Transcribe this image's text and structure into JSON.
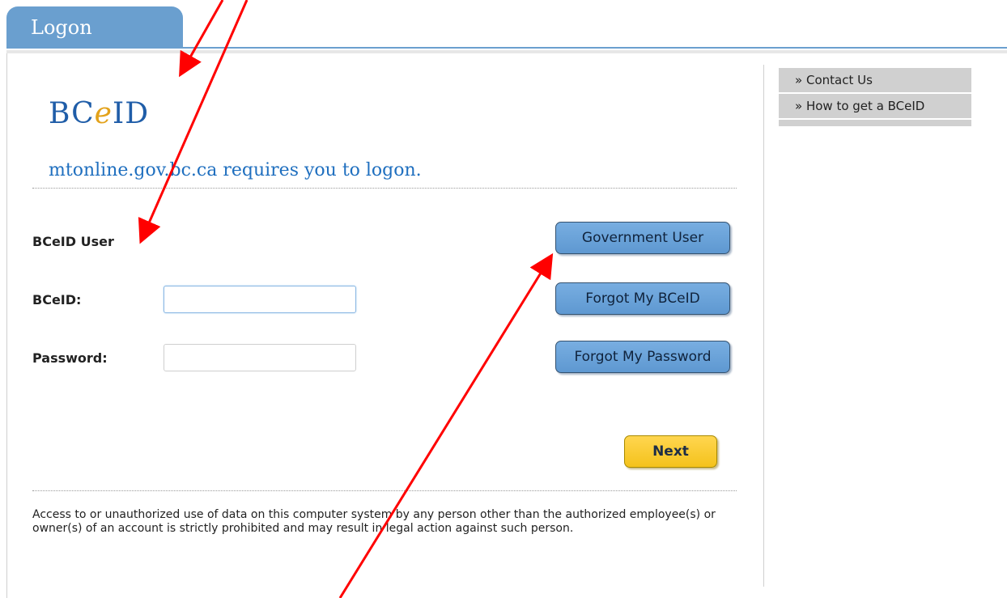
{
  "tab": {
    "label": "Logon"
  },
  "logo": {
    "part1": "BC",
    "part2": "e",
    "part3": "ID"
  },
  "headline": "mtonline.gov.bc.ca requires you to logon.",
  "form": {
    "section_label": "BCeID User",
    "bceid_label": "BCeID:",
    "bceid_value": "",
    "password_label": "Password:",
    "password_value": ""
  },
  "buttons": {
    "government_user": "Government User",
    "forgot_bceid": "Forgot My BCeID",
    "forgot_password": "Forgot My Password",
    "next": "Next"
  },
  "notice": "Access to or unauthorized use of data on this computer system by any person other than the authorized employee(s) or owner(s) of an account is strictly prohibited and may result in legal action against such person.",
  "side_menu": [
    {
      "glyph": "»",
      "label": "Contact Us"
    },
    {
      "glyph": "»",
      "label": "How to get a BCeID"
    }
  ],
  "colors": {
    "tab": "#6a9fcf",
    "primary_button": "#6ea6dc",
    "next_button": "#f7c82b",
    "annotation_arrow": "#ff0000"
  }
}
